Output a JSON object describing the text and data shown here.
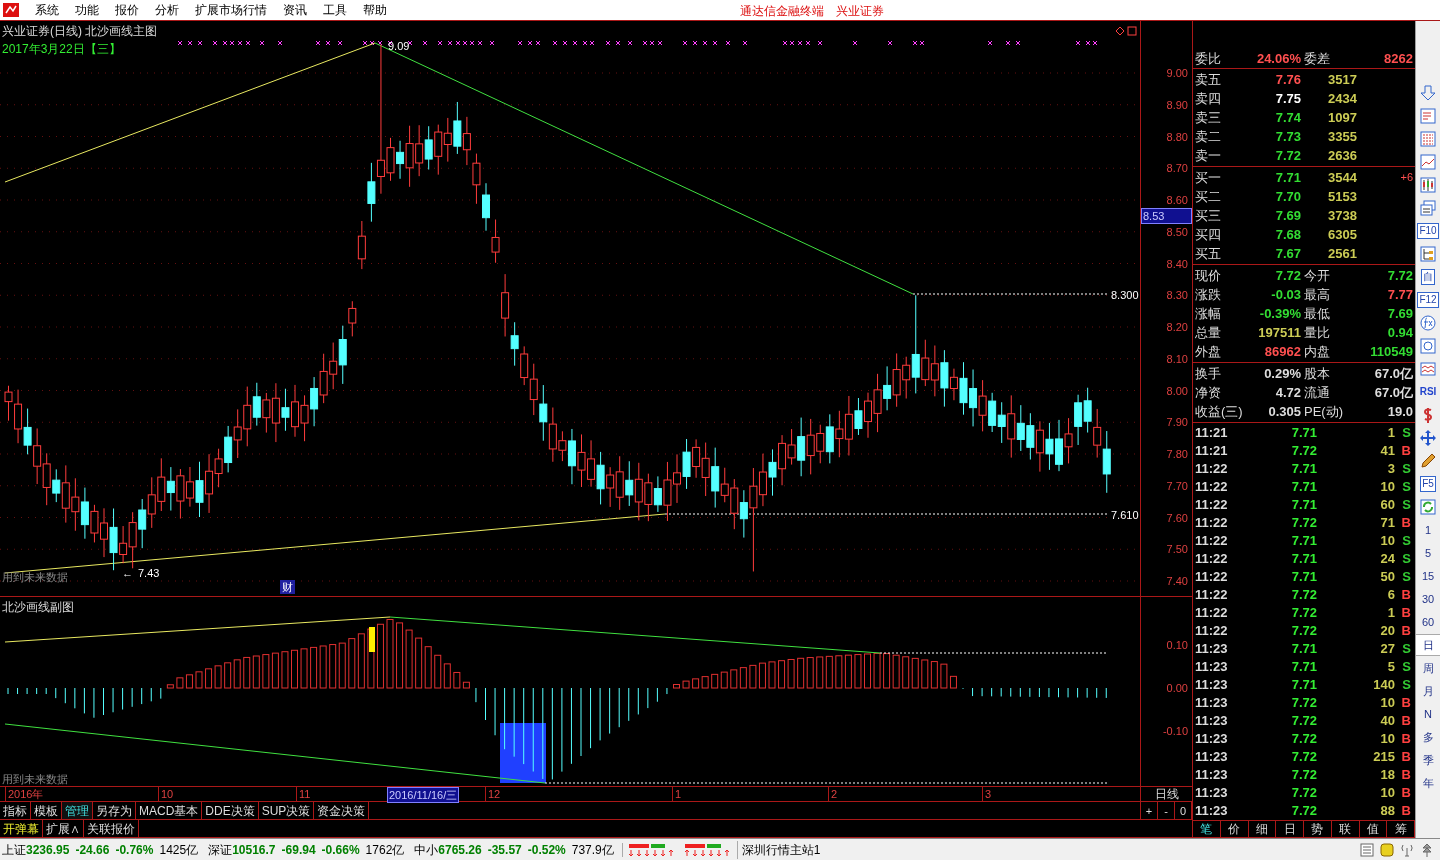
{
  "menu_bar": {
    "items": [
      "系统",
      "功能",
      "报价",
      "分析",
      "扩展市场行情",
      "资讯",
      "工具",
      "帮助"
    ],
    "center_text": [
      "通达信金融终端",
      "兴业证券"
    ]
  },
  "main_chart": {
    "title": "兴业证券(日线) 北沙画线主图",
    "date": "2017年3月22日【三】",
    "peak_label": "9.09",
    "high_label": "8.300",
    "low_label": "7.610",
    "bottom_arrow": "←",
    "bottom_label": "7.43",
    "warning": "用到未来数据",
    "finance_badge": "财",
    "price_axis": [
      "9.00",
      "8.90",
      "8.80",
      "8.70",
      "8.60",
      "8.50",
      "8.40",
      "8.30",
      "8.20",
      "8.10",
      "8.00",
      "7.90",
      "7.80",
      "7.70",
      "7.60",
      "7.50",
      "7.40"
    ],
    "cursor_price": "8.53"
  },
  "sub_chart": {
    "title": "北沙画线副图",
    "axis": [
      "0.10",
      "0.00",
      "-0.10"
    ],
    "warning": "用到未来数据"
  },
  "date_axis": {
    "labels": [
      "2016年",
      "10",
      "11",
      "12",
      "1",
      "2",
      "3"
    ],
    "cursor_date": "2016/11/16/三",
    "period": "日线"
  },
  "zoom_controls": [
    "+",
    "-",
    "0"
  ],
  "formula_tabs": [
    {
      "label": "指标",
      "selected": false
    },
    {
      "label": "模板",
      "selected": false
    },
    {
      "label": "管理",
      "selected": true
    },
    {
      "label": "另存为",
      "selected": false
    },
    {
      "label": "MACD基本",
      "selected": false
    },
    {
      "label": "DDE决策",
      "selected": false
    },
    {
      "label": "SUP决策",
      "selected": false
    },
    {
      "label": "资金决策",
      "selected": false
    }
  ],
  "extra_tabs": [
    {
      "label": "开弹幕",
      "selected": true
    },
    {
      "label": "扩展∧",
      "selected": false
    },
    {
      "label": "关联报价",
      "selected": false
    }
  ],
  "quote_panel": {
    "ratio": {
      "label": "委比",
      "value": "24.06%",
      "label2": "委差",
      "value2": "8262"
    },
    "asks": [
      {
        "label": "卖五",
        "price": "7.76",
        "color": "#ff5050",
        "volume": "3517"
      },
      {
        "label": "卖四",
        "price": "7.75",
        "color": "#ffffff",
        "volume": "2434"
      },
      {
        "label": "卖三",
        "price": "7.74",
        "color": "#33dd33",
        "volume": "1097"
      },
      {
        "label": "卖二",
        "price": "7.73",
        "color": "#33dd33",
        "volume": "3355"
      },
      {
        "label": "卖一",
        "price": "7.72",
        "color": "#33dd33",
        "volume": "2636"
      }
    ],
    "bids": [
      {
        "label": "买一",
        "price": "7.71",
        "color": "#33dd33",
        "volume": "3544",
        "change": "+6"
      },
      {
        "label": "买二",
        "price": "7.70",
        "color": "#33dd33",
        "volume": "5153"
      },
      {
        "label": "买三",
        "price": "7.69",
        "color": "#33dd33",
        "volume": "3738"
      },
      {
        "label": "买四",
        "price": "7.68",
        "color": "#33dd33",
        "volume": "6305"
      },
      {
        "label": "买五",
        "price": "7.67",
        "color": "#33dd33",
        "volume": "2561"
      }
    ],
    "stats": [
      {
        "left": {
          "label": "现价",
          "value": "7.72",
          "color": "#33dd33"
        },
        "right": {
          "label": "今开",
          "value": "7.72",
          "color": "#33dd33"
        }
      },
      {
        "left": {
          "label": "涨跌",
          "value": "-0.03",
          "color": "#33dd33"
        },
        "right": {
          "label": "最高",
          "value": "7.77",
          "color": "#ff5050"
        }
      },
      {
        "left": {
          "label": "涨幅",
          "value": "-0.39%",
          "color": "#33dd33"
        },
        "right": {
          "label": "最低",
          "value": "7.69",
          "color": "#33dd33"
        }
      },
      {
        "left": {
          "label": "总量",
          "value": "197511",
          "color": "#cccc55"
        },
        "right": {
          "label": "量比",
          "value": "0.94",
          "color": "#33dd33"
        }
      },
      {
        "left": {
          "label": "外盘",
          "value": "86962",
          "color": "#ff5050"
        },
        "right": {
          "label": "内盘",
          "value": "110549",
          "color": "#33dd33"
        }
      }
    ],
    "fundamentals": [
      {
        "label": "换手",
        "value": "0.29%",
        "label2": "股本",
        "value2": "67.0亿"
      },
      {
        "label": "净资",
        "value": "4.72",
        "label2": "流通",
        "value2": "67.0亿"
      },
      {
        "label": "收益(三)",
        "value": "0.305",
        "label2": "PE(动)",
        "value2": "19.0"
      }
    ]
  },
  "ticks": [
    {
      "time": "11:21",
      "price": "7.71",
      "volume": "1",
      "side": "S",
      "color": "#33cc33"
    },
    {
      "time": "11:21",
      "price": "7.72",
      "volume": "41",
      "side": "B",
      "color": "#ff4040"
    },
    {
      "time": "11:22",
      "price": "7.71",
      "volume": "3",
      "side": "S",
      "color": "#33cc33"
    },
    {
      "time": "11:22",
      "price": "7.71",
      "volume": "10",
      "side": "S",
      "color": "#33cc33"
    },
    {
      "time": "11:22",
      "price": "7.71",
      "volume": "60",
      "side": "S",
      "color": "#33cc33"
    },
    {
      "time": "11:22",
      "price": "7.72",
      "volume": "71",
      "side": "B",
      "color": "#ff4040"
    },
    {
      "time": "11:22",
      "price": "7.71",
      "volume": "10",
      "side": "S",
      "color": "#33cc33"
    },
    {
      "time": "11:22",
      "price": "7.71",
      "volume": "24",
      "side": "S",
      "color": "#33cc33"
    },
    {
      "time": "11:22",
      "price": "7.71",
      "volume": "50",
      "side": "S",
      "color": "#33cc33"
    },
    {
      "time": "11:22",
      "price": "7.72",
      "volume": "6",
      "side": "B",
      "color": "#ff4040"
    },
    {
      "time": "11:22",
      "price": "7.72",
      "volume": "1",
      "side": "B",
      "color": "#ff4040"
    },
    {
      "time": "11:22",
      "price": "7.72",
      "volume": "20",
      "side": "B",
      "color": "#ff4040"
    },
    {
      "time": "11:23",
      "price": "7.71",
      "volume": "27",
      "side": "S",
      "color": "#33cc33"
    },
    {
      "time": "11:23",
      "price": "7.71",
      "volume": "5",
      "side": "S",
      "color": "#33cc33"
    },
    {
      "time": "11:23",
      "price": "7.71",
      "volume": "140",
      "side": "S",
      "color": "#33cc33"
    },
    {
      "time": "11:23",
      "price": "7.72",
      "volume": "10",
      "side": "B",
      "color": "#ff4040"
    },
    {
      "time": "11:23",
      "price": "7.72",
      "volume": "40",
      "side": "B",
      "color": "#ff4040"
    },
    {
      "time": "11:23",
      "price": "7.72",
      "volume": "10",
      "side": "B",
      "color": "#ff4040"
    },
    {
      "time": "11:23",
      "price": "7.72",
      "volume": "215",
      "side": "B",
      "color": "#ff4040"
    },
    {
      "time": "11:23",
      "price": "7.72",
      "volume": "18",
      "side": "B",
      "color": "#ff4040"
    },
    {
      "time": "11:23",
      "price": "7.72",
      "volume": "10",
      "side": "B",
      "color": "#ff4040"
    },
    {
      "time": "11:23",
      "price": "7.72",
      "volume": "88",
      "side": "B",
      "color": "#ff4040"
    }
  ],
  "panel_tabs": [
    {
      "label": "笔",
      "selected": true
    },
    {
      "label": "价",
      "selected": false
    },
    {
      "label": "细",
      "selected": false
    },
    {
      "label": "日",
      "selected": false
    },
    {
      "label": "势",
      "selected": false
    },
    {
      "label": "联",
      "selected": false
    },
    {
      "label": "值",
      "selected": false
    },
    {
      "label": "筹",
      "selected": false
    }
  ],
  "side_toolbar": [
    {
      "kind": "icon"
    },
    {
      "kind": "icon"
    },
    {
      "kind": "icon"
    },
    {
      "kind": "icon"
    },
    {
      "kind": "icon"
    },
    {
      "kind": "icon"
    },
    {
      "kind": "boxed",
      "label": "F10"
    },
    {
      "kind": "icon"
    },
    {
      "kind": "boxed",
      "label": "自"
    },
    {
      "kind": "boxed",
      "label": "F12"
    },
    {
      "kind": "icon"
    },
    {
      "kind": "icon"
    },
    {
      "kind": "icon"
    },
    {
      "kind": "label",
      "label": "RSI"
    },
    {
      "kind": "icon"
    },
    {
      "kind": "icon"
    },
    {
      "kind": "icon"
    },
    {
      "kind": "boxed",
      "label": "F5"
    },
    {
      "kind": "icon"
    },
    {
      "kind": "period",
      "label": "1",
      "selected": false
    },
    {
      "kind": "period",
      "label": "5",
      "selected": false
    },
    {
      "kind": "period",
      "label": "15",
      "selected": false
    },
    {
      "kind": "period",
      "label": "30",
      "selected": false
    },
    {
      "kind": "period",
      "label": "60",
      "selected": false
    },
    {
      "kind": "period",
      "label": "日",
      "selected": true
    },
    {
      "kind": "period",
      "label": "周",
      "selected": false
    },
    {
      "kind": "period",
      "label": "月",
      "selected": false
    },
    {
      "kind": "period",
      "label": "N",
      "selected": false
    },
    {
      "kind": "period",
      "label": "多",
      "selected": false
    },
    {
      "kind": "period",
      "label": "季",
      "selected": false
    },
    {
      "kind": "period",
      "label": "年",
      "selected": false
    }
  ],
  "status_bar": {
    "indices": [
      {
        "name": "上证",
        "value": "3236.95",
        "change": "-24.66",
        "percent": "-0.76%",
        "amount": "1425亿"
      },
      {
        "name": "深证",
        "value": "10516.7",
        "change": "-69.94",
        "percent": "-0.66%",
        "amount": "1762亿"
      },
      {
        "name": "中小",
        "value": "6765.26",
        "change": "-35.57",
        "percent": "-0.52%",
        "amount": "737.9亿"
      }
    ],
    "server": "深圳行情主站1"
  }
}
